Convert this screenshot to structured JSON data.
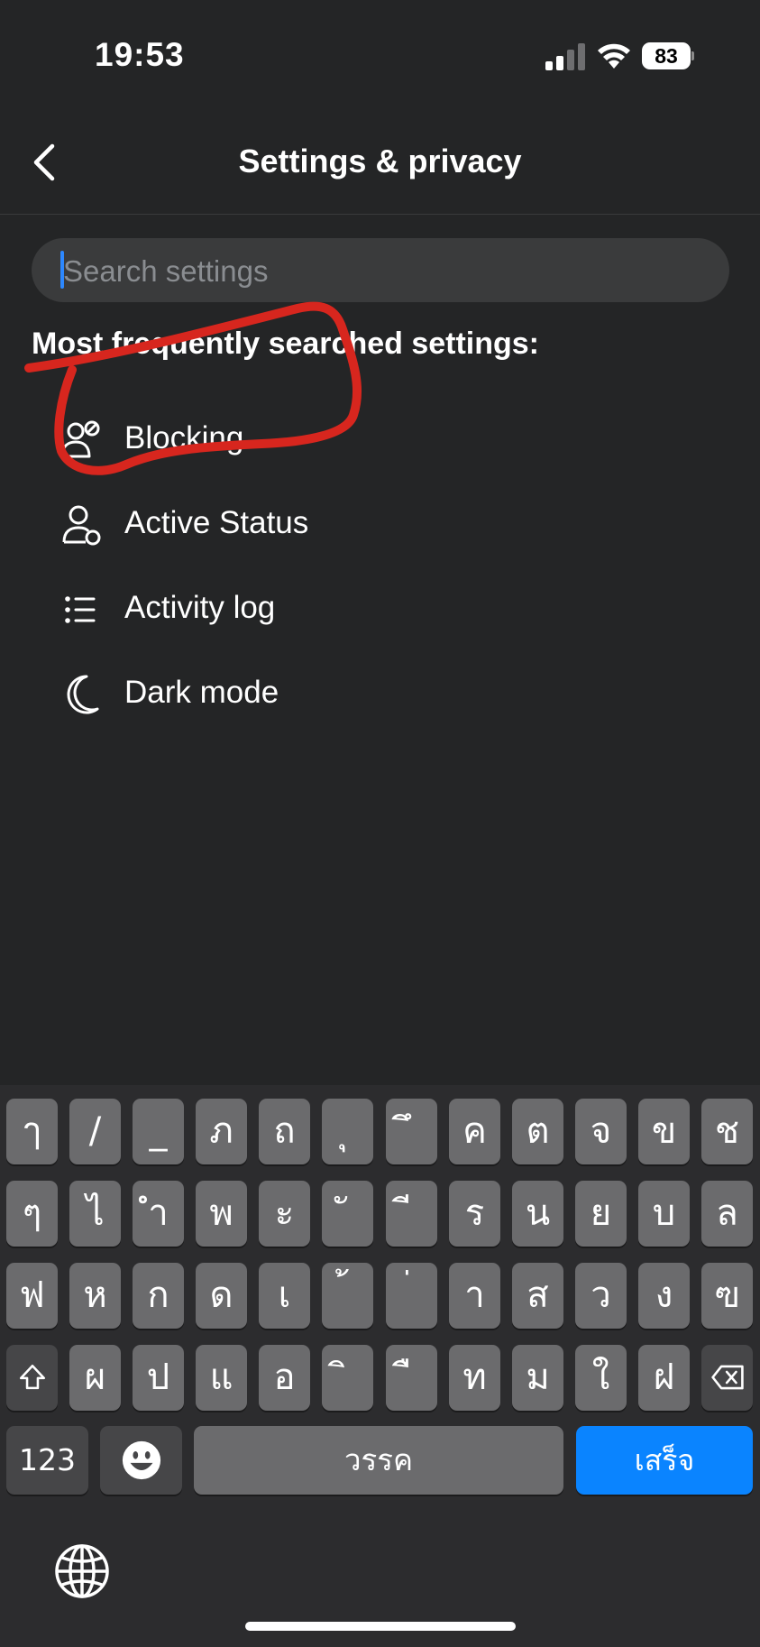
{
  "status_bar": {
    "time": "19:53",
    "battery": "83"
  },
  "header": {
    "title": "Settings & privacy",
    "back_icon": "chevron-left-icon"
  },
  "search": {
    "placeholder": "Search settings"
  },
  "section_label": "Most frequently searched settings:",
  "items": [
    {
      "label": "Blocking",
      "icon": "user-block-icon"
    },
    {
      "label": "Active Status",
      "icon": "user-status-icon"
    },
    {
      "label": "Activity log",
      "icon": "list-icon"
    },
    {
      "label": "Dark mode",
      "icon": "moon-icon"
    }
  ],
  "annotation": {
    "color": "#d7261e",
    "shape": "hand-drawn circle around Blocking"
  },
  "keyboard": {
    "row1": [
      "ๅ",
      "/",
      "_",
      "ภ",
      "ถ",
      "ุ",
      "ึ",
      "ค",
      "ต",
      "จ",
      "ข",
      "ช"
    ],
    "row2": [
      "ๆ",
      "ไ",
      "ำ",
      "พ",
      "ะ",
      "ั",
      "ี",
      "ร",
      "น",
      "ย",
      "บ",
      "ล"
    ],
    "row3": [
      "ฟ",
      "ห",
      "ก",
      "ด",
      "เ",
      "้",
      "่",
      "า",
      "ส",
      "ว",
      "ง",
      "ฃ"
    ],
    "row4": [
      "ผ",
      "ป",
      "แ",
      "อ",
      "ิ",
      "ื",
      "ท",
      "ม",
      "ใ",
      "ฝ"
    ],
    "numbers_label": "123",
    "space_label": "วรรค",
    "done_label": "เสร็จ",
    "done_color": "#0a84ff"
  }
}
